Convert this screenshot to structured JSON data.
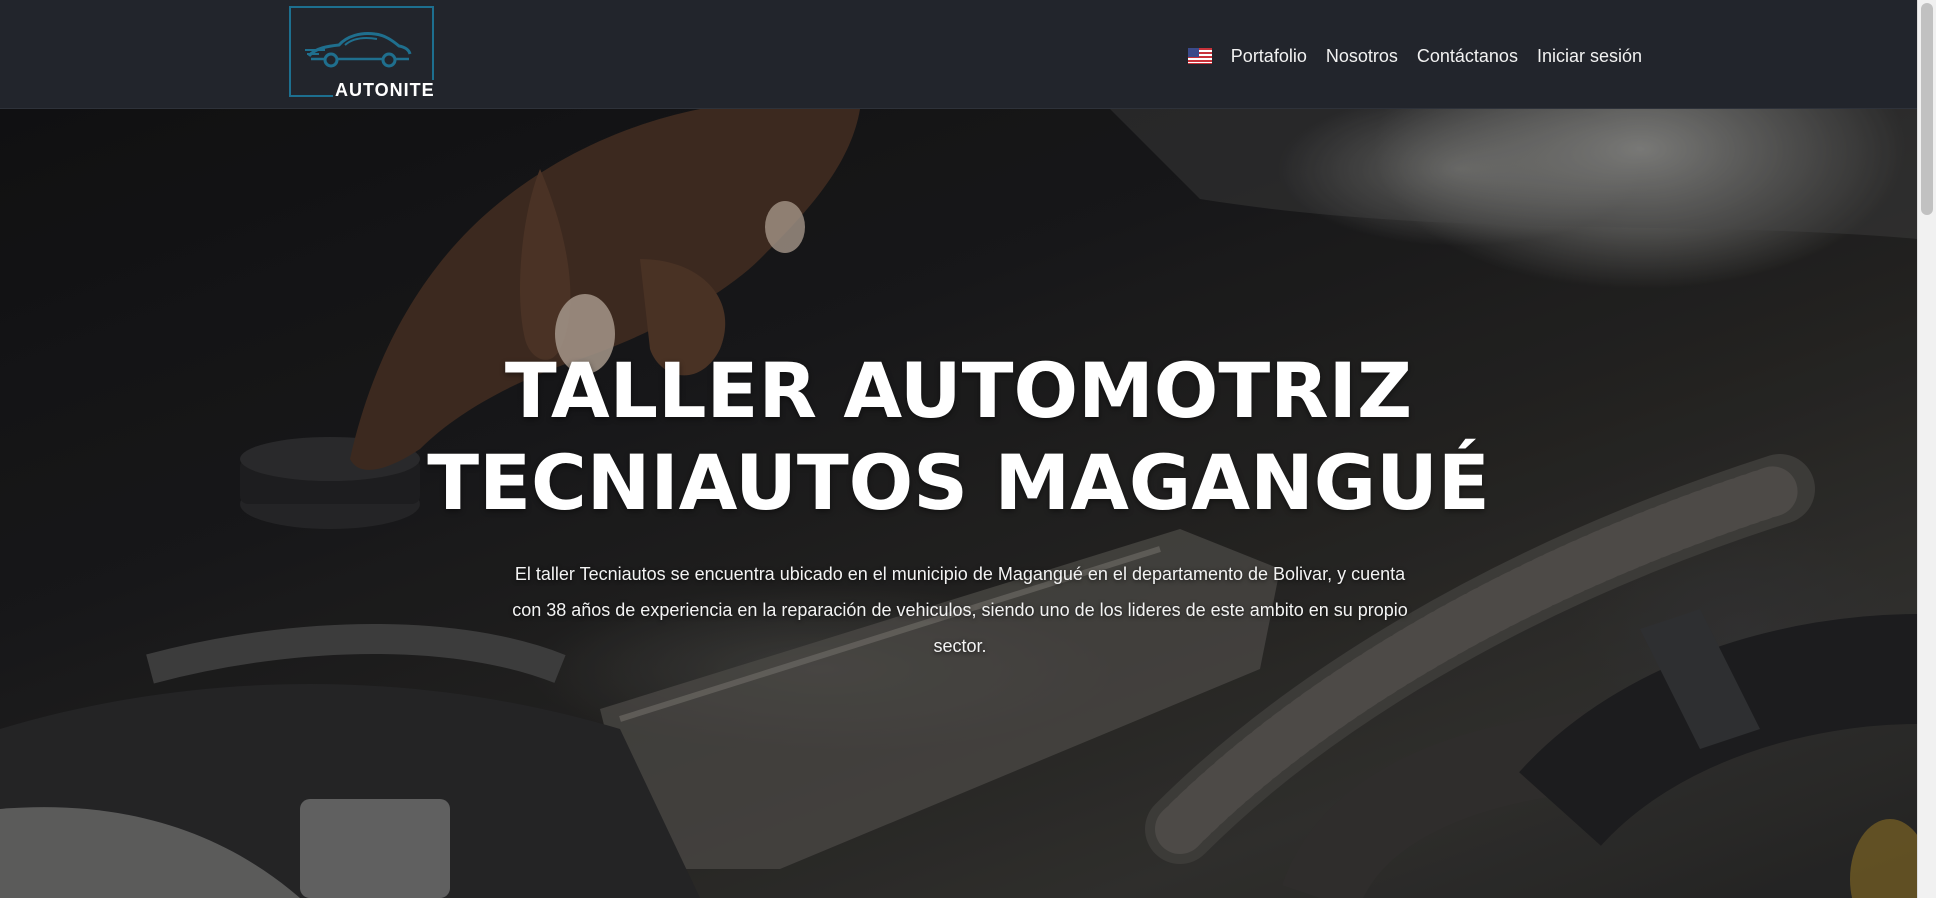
{
  "logo": {
    "text": "AUTONITE",
    "icon": "car-icon",
    "accent_color": "#1d6f8f"
  },
  "nav": {
    "flag_icon": "us-flag-icon",
    "items": [
      {
        "label": "Portafolio"
      },
      {
        "label": "Nosotros"
      },
      {
        "label": "Contáctanos"
      },
      {
        "label": "Iniciar sesión"
      }
    ]
  },
  "hero": {
    "title_line1": "TALLER AUTOMOTRIZ",
    "title_line2": "TECNIAUTOS MAGANGUÉ",
    "description": "El taller Tecniautos se encuentra ubicado en el municipio de Magangué en el departamento de Bolivar, y cuenta con 38 años de experiencia en la reparación de vehiculos, siendo uno de los lideres de este ambito en su propio sector.",
    "background": "car-engine-photo"
  },
  "colors": {
    "navbar_bg": "#22252c",
    "text": "#ffffff"
  }
}
